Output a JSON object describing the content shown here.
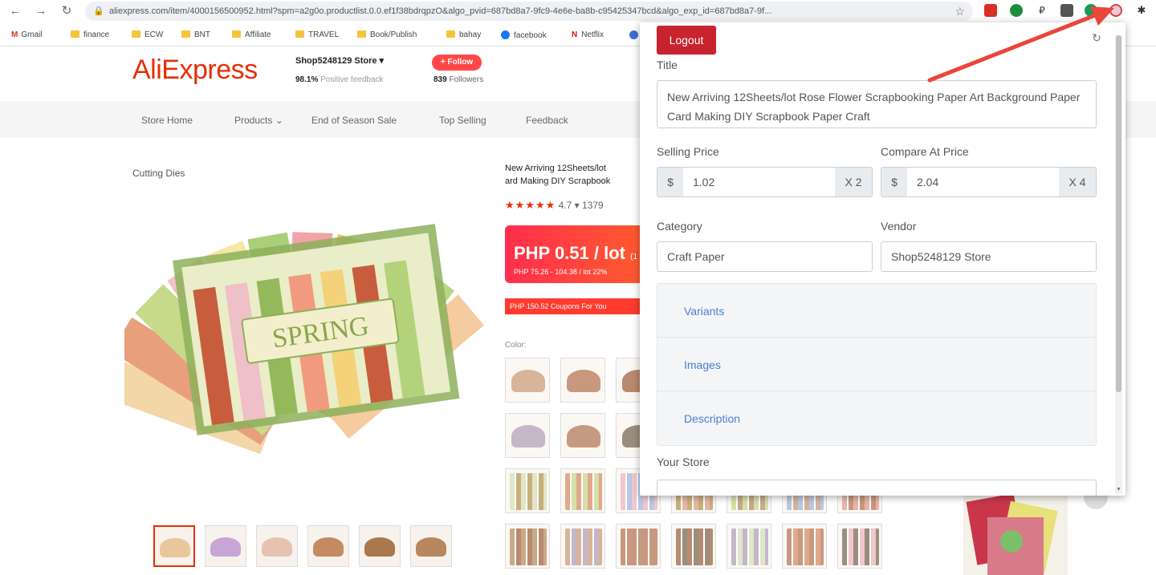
{
  "browser": {
    "url": "aliexpress.com/item/4000156500952.html?spm=a2g0o.productlist.0.0.ef1f38bdrqpzO&algo_pvid=687bd8a7-9fc9-4e6e-ba8b-c95425347bcd&algo_exp_id=687bd8a7-9f...",
    "bookmarks": [
      "Gmail",
      "finance",
      "ECW",
      "BNT",
      "Affiliate",
      "TRAVEL",
      "Book/Publish",
      "bahay",
      "facebook",
      "Netflix"
    ],
    "colors": {
      "ext_red": "#d93025",
      "ext_green": "#1e8e3e",
      "ext_teal": "#0f9d58"
    }
  },
  "store": {
    "logo": "AliExpress",
    "name": "Shop5248129 Store",
    "feedback_pct": "98.1%",
    "feedback_label": "Positive feedback",
    "follow_label": "+ Follow",
    "followers_count": "839",
    "followers_label": "Followers",
    "nav": [
      "Store Home",
      "Products",
      "End of Season Sale",
      "Top Selling",
      "Feedback"
    ],
    "category": "Cutting Dies"
  },
  "product": {
    "title_line1": "New Arriving 12Sheets/lot",
    "title_line2": "ard Making DIY Scrapbook",
    "rating": "4.7",
    "reviews": "1379",
    "price": "PHP 0.51 / lot",
    "price_note": "(1",
    "price_sub": "PHP 75.26 - 104.38 / lot   22%",
    "coupon": "PHP 150.52 Coupons For You",
    "color_label": "Color:",
    "image_text": "SPRING"
  },
  "popup": {
    "logout": "Logout",
    "title_label": "Title",
    "title_value": "New Arriving 12Sheets/lot Rose Flower Scrapbooking Paper Art Background Paper Card Making DIY Scrapbook Paper Craft",
    "selling_price_label": "Selling Price",
    "selling_currency": "$",
    "selling_price": "1.02",
    "selling_multiplier": "X 2",
    "compare_price_label": "Compare At Price",
    "compare_currency": "$",
    "compare_price": "2.04",
    "compare_multiplier": "X 4",
    "category_label": "Category",
    "category_value": "Craft Paper",
    "vendor_label": "Vendor",
    "vendor_value": "Shop5248129 Store",
    "accordion": [
      "Variants",
      "Images",
      "Description"
    ],
    "store_label": "Your Store"
  },
  "accent_color": "#c8232e",
  "link_color": "#4a7fd4"
}
